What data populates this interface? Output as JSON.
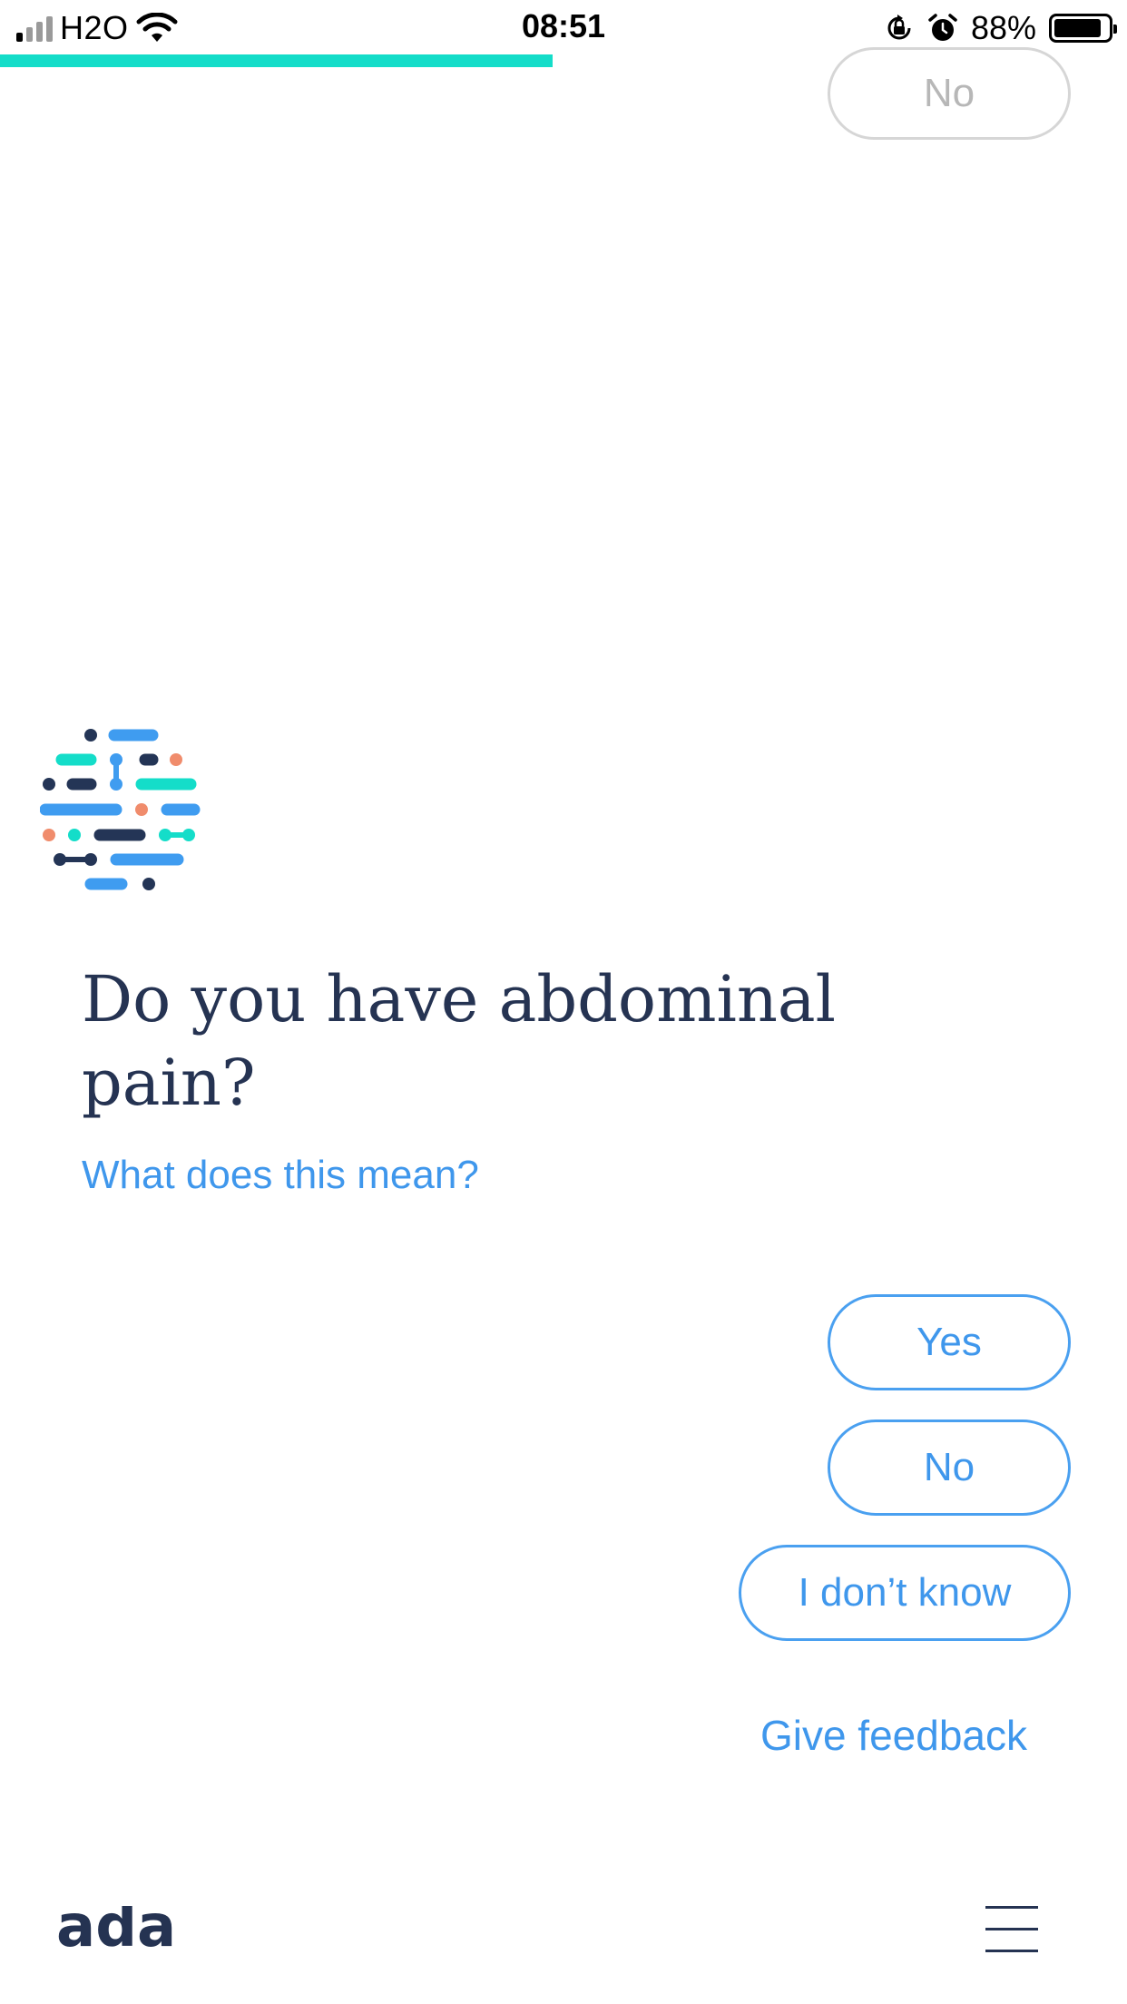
{
  "status_bar": {
    "carrier": "H2O",
    "time": "08:51",
    "battery_percent": "88%",
    "battery_level": 0.88,
    "signal_bars_active": 1,
    "signal_bars_total": 4,
    "icons": [
      "signal-icon",
      "wifi-icon",
      "orientation-lock-icon",
      "alarm-icon",
      "battery-icon"
    ]
  },
  "progress": {
    "fraction": 0.49,
    "color": "#14ddc9"
  },
  "previous_answer": {
    "label": "No"
  },
  "question": {
    "text": "Do you have abdominal pain?",
    "explain_link": "What does this mean?"
  },
  "answers": [
    {
      "label": "Yes"
    },
    {
      "label": "No"
    },
    {
      "label": "I don’t know"
    }
  ],
  "feedback_link": "Give feedback",
  "footer": {
    "brand": "ada",
    "menu_icon": "hamburger-menu-icon"
  },
  "colors": {
    "accent": "#3f97ec",
    "text_dark": "#253352",
    "teal": "#14ddc9",
    "salmon": "#f08c6c",
    "navy": "#243556"
  }
}
